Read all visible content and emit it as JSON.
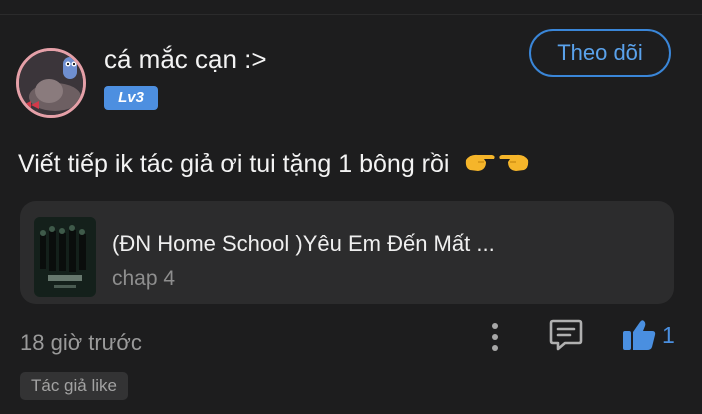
{
  "post": {
    "username": "cá mắc cạn :>",
    "level": "Lv3",
    "follow_label": "Theo dõi",
    "comment_text": "Viết tiếp ik tác giả ơi tui tặng 1 bông rồi",
    "story_card": {
      "title": "(ĐN Home School )Yêu Em Đến Mất ...",
      "subtitle": "chap 4"
    },
    "timestamp": "18 giờ trước",
    "like_count": "1",
    "tag": "Tác giả like",
    "icons": {
      "more": "more-vertical-icon",
      "reply": "comment-icon",
      "like": "thumbs-up-icon",
      "emoji": "pointing-hands-emoji"
    },
    "colors": {
      "background": "#1d1d1e",
      "card": "#2c2c2d",
      "accent": "#4a8fe0",
      "level_badge": "#4d8fe0",
      "avatar_ring": "#e5a0a8"
    }
  }
}
